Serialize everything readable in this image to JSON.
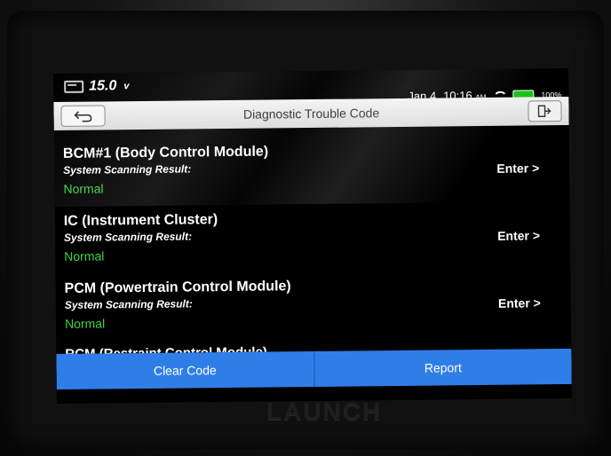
{
  "status_bar": {
    "voltage_value": "15.0",
    "voltage_unit": "v",
    "date": "Jan 4",
    "time": "10:16",
    "ampm": "AM",
    "battery_percent": "100%"
  },
  "header": {
    "title": "Diagnostic Trouble Code"
  },
  "modules": [
    {
      "name": "BCM#1 (Body Control Module)",
      "scan_label": "System Scanning Result:",
      "result": "Normal",
      "enter_label": "Enter >"
    },
    {
      "name": "IC (Instrument Cluster)",
      "scan_label": "System Scanning Result:",
      "result": "Normal",
      "enter_label": "Enter >"
    },
    {
      "name": "PCM (Powertrain Control Module)",
      "scan_label": "System Scanning Result:",
      "result": "Normal",
      "enter_label": "Enter >"
    }
  ],
  "partial_module_name": "RCM (Restraint Control Module)",
  "bottom_buttons": {
    "clear_code": "Clear Code",
    "report": "Report"
  },
  "brand": "LAUNCH",
  "colors": {
    "normal_green": "#3fd43f",
    "button_blue": "#2f7ee8",
    "battery_green": "#18c418"
  }
}
